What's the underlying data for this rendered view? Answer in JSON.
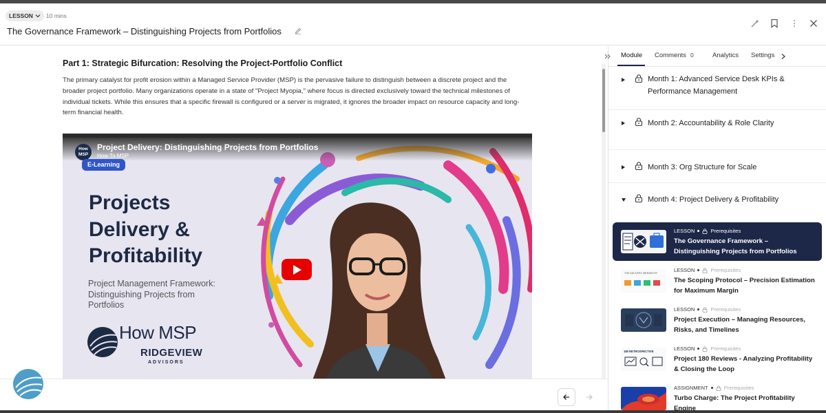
{
  "header": {
    "chip": "LESSON",
    "duration": "10 mins",
    "title": "The Governance Framework – Distinguishing Projects from Portfolios"
  },
  "content": {
    "section_title": "Part 1: Strategic Bifurcation: Resolving the Project-Portfolio Conflict",
    "paragraph": "The primary catalyst for profit erosion within a Managed Service Provider (MSP) is the pervasive failure to distinguish between a discrete project and the broader project portfolio. Many organizations operate in a state of \"Project Myopia,\" where focus is directed exclusively toward the technical milestones of individual tickets. While this ensures that a specific firewall is configured or a server is migrated, it ignores the broader impact on resource capacity and long-term financial health."
  },
  "video": {
    "logo_text": "How MSP",
    "title": "Project Delivery: Distinguishing Projects from Portfolios",
    "channel": "How To MSP",
    "tag": "E-Learning",
    "heading_1": "Projects",
    "heading_2": "Delivery &",
    "heading_3": "Profitability",
    "subheading": "Project Management Framework: Distinguishing Projects from Portfolios",
    "brand_how": "How MSP",
    "brand_ridge": "RIDGEVIEW",
    "brand_advisors": "ADVISORS"
  },
  "panel": {
    "tabs": [
      {
        "label": "Module"
      },
      {
        "label": "Comments",
        "count": "0"
      },
      {
        "label": "Analytics"
      },
      {
        "label": "Settings"
      }
    ],
    "modules": [
      {
        "label": "Month 1: Advanced Service Desk KPIs & Performance Management",
        "expanded": false
      },
      {
        "label": "Month 2: Accountability & Role Clarity",
        "expanded": false
      },
      {
        "label": "Month 3: Org Structure for Scale",
        "expanded": false
      },
      {
        "label": "Month 4: Project Delivery & Profitability",
        "expanded": true
      }
    ],
    "items": [
      {
        "type": "LESSON",
        "prereq": "Prerequisites",
        "title": "The Governance Framework – Distinguishing Projects from Portfolios",
        "active": true
      },
      {
        "type": "LESSON",
        "prereq": "Prerequisites",
        "title": "The Scoping Protocol – Precision Estimation for Maximum Margin",
        "active": false
      },
      {
        "type": "LESSON",
        "prereq": "Prerequisites",
        "title": "Project Execution – Managing Resources, Risks, and Timelines",
        "active": false
      },
      {
        "type": "LESSON",
        "prereq": "Prerequisites",
        "title": "Project 180 Reviews - Analyzing Profitability & Closing the Loop",
        "active": false
      },
      {
        "type": "ASSIGNMENT",
        "prereq": "Prerequisites",
        "title": "Turbo Charge: The Project Profitability Engine",
        "active": false
      }
    ],
    "thumb_labels": [
      "THE DELIVERY HIERARCHY",
      "180 RETROSPECTIVE"
    ]
  },
  "colors": {
    "active_item": "#1d2848",
    "youtube_red": "#e60000",
    "elearning_blue": "#2f57c8"
  }
}
